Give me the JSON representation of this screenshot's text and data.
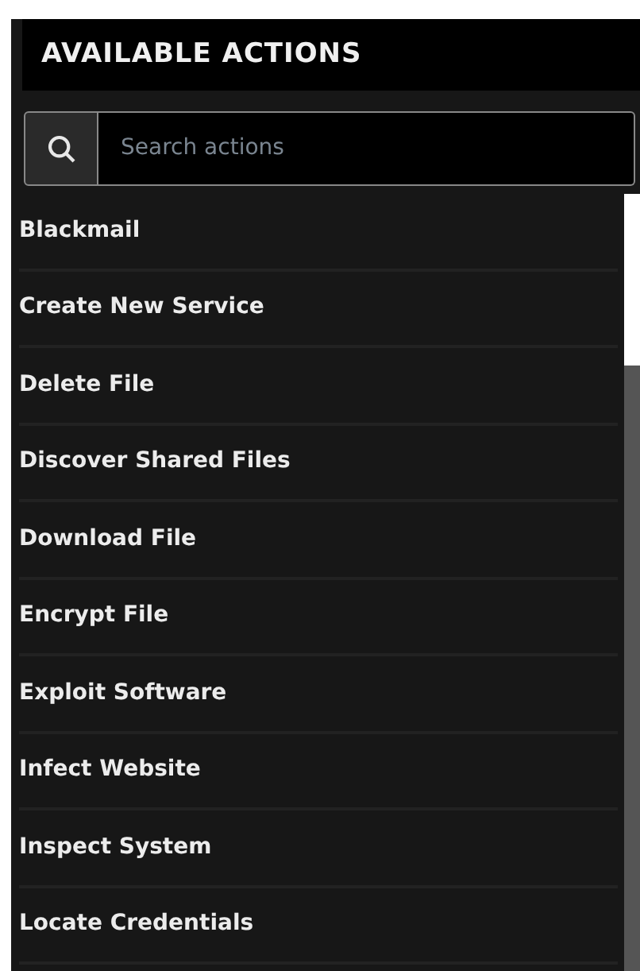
{
  "panel": {
    "title": "AVAILABLE ACTIONS"
  },
  "search": {
    "placeholder": "Search actions"
  },
  "actions": [
    {
      "label": "Blackmail"
    },
    {
      "label": "Create New Service"
    },
    {
      "label": "Delete File"
    },
    {
      "label": "Discover Shared Files"
    },
    {
      "label": "Download File"
    },
    {
      "label": "Encrypt File"
    },
    {
      "label": "Exploit Software"
    },
    {
      "label": "Infect Website"
    },
    {
      "label": "Inspect System"
    },
    {
      "label": "Locate Credentials"
    }
  ]
}
